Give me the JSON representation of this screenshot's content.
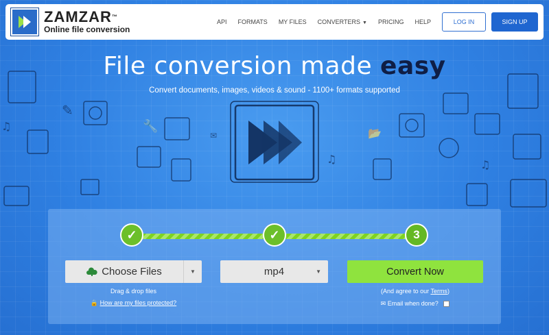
{
  "header": {
    "logo_name": "ZAMZAR",
    "logo_tm": "™",
    "logo_tagline": "Online file conversion",
    "nav": [
      {
        "label": "API"
      },
      {
        "label": "FORMATS"
      },
      {
        "label": "MY FILES"
      },
      {
        "label": "CONVERTERS",
        "has_dropdown": true
      },
      {
        "label": "PRICING"
      },
      {
        "label": "HELP"
      }
    ],
    "login_label": "LOG IN",
    "signup_label": "SIGN UP"
  },
  "hero": {
    "headline_prefix": "File conversion made ",
    "headline_emphasis": "easy",
    "subheadline": "Convert documents, images, videos & sound - 1100+ formats supported"
  },
  "converter": {
    "steps": [
      {
        "state": "done",
        "symbol": "✓"
      },
      {
        "state": "done",
        "symbol": "✓"
      },
      {
        "state": "current",
        "symbol": "3"
      }
    ],
    "choose_files_label": "Choose Files",
    "drag_drop_text": "Drag & drop files",
    "protected_link": "How are my files protected?",
    "format_value": "mp4",
    "convert_label": "Convert Now",
    "agree_prefix": "(And agree to our ",
    "agree_link": "Terms",
    "agree_suffix": ")",
    "email_label": "Email when done?"
  },
  "colors": {
    "brand_blue": "#1f66d0",
    "hero_blue": "#2f80e2",
    "progress_green": "#7ed321",
    "convert_green": "#8fe33e",
    "headline_dark": "#0f1e45"
  }
}
